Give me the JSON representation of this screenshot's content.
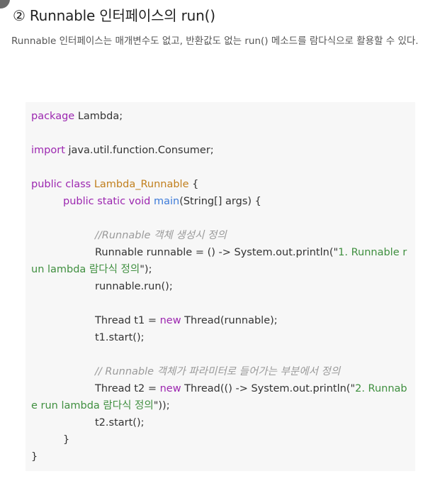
{
  "heading": "② Runnable 인터페이스의 run()",
  "description": "Runnable 인터페이스는 매개변수도 없고, 반환값도 없는 run() 메소드를 람다식으로 활용할 수 있다.",
  "code": {
    "l1_kw": "package",
    "l1_rest": " Lambda;",
    "l3_kw": "import",
    "l3_rest": " java.util.function.Consumer;",
    "l5_kw": "public class",
    "l5_sp": " ",
    "l5_cls": "Lambda_Runnable",
    "l5_rest": " {",
    "l6_kw": "public static void",
    "l6_sp": " ",
    "l6_fn": "main",
    "l6_rest": "(String[] args) {",
    "l8_cmt": "//Runnable 객체 생성시 정의",
    "l9_plain": "Runnable runnable = () -> System.out.println(\"",
    "l9_str": "1. Runnable r",
    "l10_str": "un lambda 람다식 정의",
    "l10_rest": "\");",
    "l11_plain": "runnable.run();",
    "l13_plain1": "Thread t1 = ",
    "l13_kw": "new",
    "l13_plain2": " Thread(runnable);",
    "l14_plain": "t1.start();",
    "l16_cmt": "// Runnable 객체가 파라미터로 들어가는 부분에서 정의",
    "l17_plain1": "Thread t2 = ",
    "l17_kw": "new",
    "l17_plain2": " Thread(() -> System.out.println(\"",
    "l17_str": "2. Runnabl",
    "l18_str": "e run lambda 람다식 정의",
    "l18_rest": "\"));",
    "l19_plain": "t2.start();",
    "l20_plain": "}",
    "l21_plain": "}"
  }
}
